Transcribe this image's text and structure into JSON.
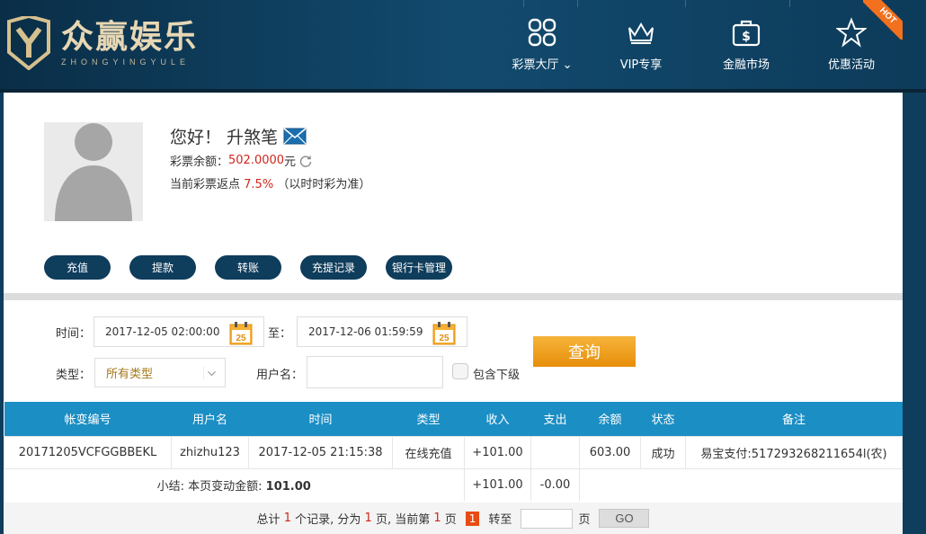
{
  "header": {
    "logo_cn": "众赢娱乐",
    "logo_en": "ZHONGYINGYULE",
    "nav": [
      {
        "label": "彩票大厅",
        "icon": "grid-icon"
      },
      {
        "label": "VIP专享",
        "icon": "crown-icon"
      },
      {
        "label": "金融市场",
        "icon": "money-bag-icon"
      },
      {
        "label": "优惠活动",
        "icon": "star-icon"
      }
    ],
    "hot_badge": "HOT"
  },
  "profile": {
    "greeting": "您好！ 升煞笔",
    "balance_label": "彩票余额：",
    "balance_value": "502.0000",
    "balance_unit": "元",
    "rebate_label": "当前彩票返点",
    "rebate_value": "7.5%",
    "rebate_note": "（以时时彩为准）"
  },
  "actions": [
    "充值",
    "提款",
    "转账",
    "充提记录",
    "银行卡管理"
  ],
  "filter": {
    "time_label": "时间：",
    "start": "2017-12-05 02:00:00",
    "to_label": "至：",
    "end": "2017-12-06 01:59:59",
    "calendar_day": "25",
    "type_label": "类型：",
    "type_value": "所有类型",
    "username_label": "用户名：",
    "username_value": "",
    "include_sub_label": "包含下级",
    "query_label": "查询"
  },
  "table": {
    "headers": [
      "帐变编号",
      "用户名",
      "时间",
      "类型",
      "收入",
      "支出",
      "余额",
      "状态",
      "备注"
    ],
    "rows": [
      [
        "20171205VCFGGBBEKL",
        "zhizhu123",
        "2017-12-05 21:15:38",
        "在线充值",
        "+101.00",
        "",
        "603.00",
        "成功",
        "易宝支付:517293268211654l(农)"
      ]
    ],
    "summary": {
      "label": "小结: 本页变动金额: ",
      "amount": "101.00",
      "income": "+101.00",
      "expense": "-0.00"
    }
  },
  "pager": {
    "total_prefix": "总计",
    "total": "1",
    "records_text": "个记录, 分为",
    "pages": "1",
    "pages_text": "页, 当前第",
    "current": "1",
    "page_text": "页",
    "current_btn": "1",
    "jump_label": "转至",
    "page_unit": "页",
    "go_label": "GO"
  }
}
